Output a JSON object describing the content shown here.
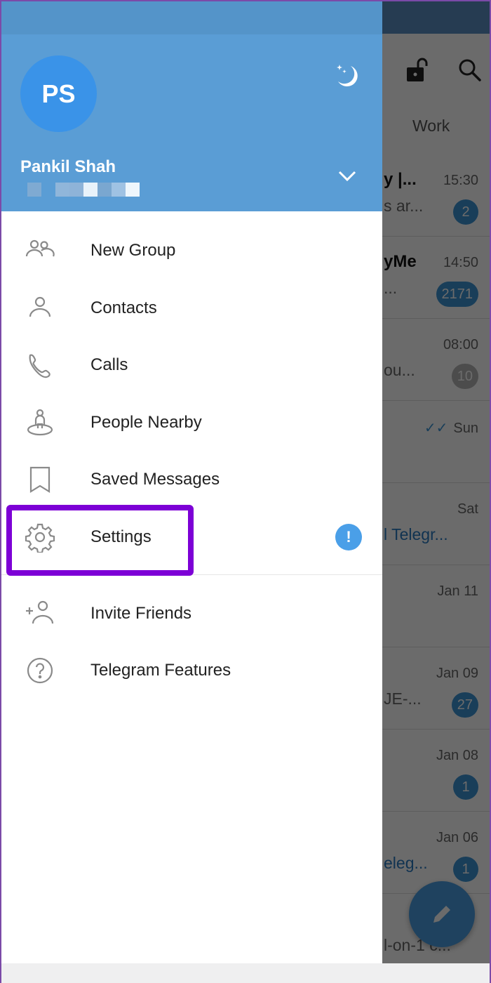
{
  "chat_list": {
    "tab": "Work",
    "top_icons": [
      "lock-open-icon",
      "search-icon"
    ],
    "rows": [
      {
        "title": "y |...",
        "preview": "s ar...",
        "time": "15:30",
        "badge": "2",
        "muted": false,
        "link": false
      },
      {
        "title": "yMe",
        "preview": "...",
        "time": "14:50",
        "badge": "2171",
        "muted": false,
        "link": false
      },
      {
        "title": "",
        "preview": "ou...",
        "time": "08:00",
        "badge": "10",
        "muted": true,
        "link": false
      },
      {
        "title": "",
        "preview": "",
        "time": "Sun",
        "badge": "",
        "muted": false,
        "link": false,
        "read_check": true
      },
      {
        "title": "",
        "preview": "l Telegr...",
        "time": "Sat",
        "badge": "",
        "muted": false,
        "link": true
      },
      {
        "title": "",
        "preview": "",
        "time": "Jan 11",
        "badge": "",
        "muted": false,
        "link": false
      },
      {
        "title": "",
        "preview": "JE-...",
        "time": "Jan 09",
        "badge": "27",
        "muted": false,
        "link": false
      },
      {
        "title": "",
        "preview": "",
        "time": "Jan 08",
        "badge": "1",
        "muted": false,
        "link": false
      },
      {
        "title": "",
        "preview": "eleg...",
        "time": "Jan 06",
        "badge": "1",
        "muted": false,
        "link": true
      },
      {
        "title": "",
        "preview": "l-on-1 c...",
        "time": "",
        "badge": "",
        "muted": false,
        "link": false
      }
    ],
    "fab_icon": "pencil-icon"
  },
  "drawer": {
    "avatar_initials": "PS",
    "profile_name": "Pankil Shah",
    "night_mode_icon": "moon-icon",
    "accounts_toggle_icon": "chevron-down-icon",
    "menu": [
      {
        "label": "New Group",
        "icon": "group-icon"
      },
      {
        "label": "Contacts",
        "icon": "person-icon"
      },
      {
        "label": "Calls",
        "icon": "phone-icon"
      },
      {
        "label": "People Nearby",
        "icon": "people-nearby-icon"
      },
      {
        "label": "Saved Messages",
        "icon": "bookmark-icon"
      },
      {
        "label": "Settings",
        "icon": "gear-icon",
        "alert": "!"
      },
      {
        "label": "Invite Friends",
        "icon": "add-person-icon"
      },
      {
        "label": "Telegram Features",
        "icon": "question-icon"
      }
    ]
  },
  "annotation": {
    "highlighted_item": "Settings",
    "color": "#7d00d6"
  }
}
